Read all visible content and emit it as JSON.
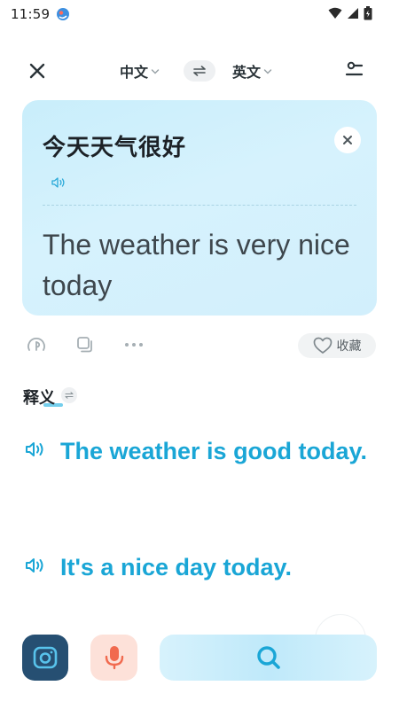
{
  "status_bar": {
    "time": "11:59"
  },
  "nav": {
    "source_lang": "中文",
    "target_lang": "英文"
  },
  "card": {
    "source_text": "今天天气很好",
    "translation": "The weather is very nice today"
  },
  "actions": {
    "favorite_label": "收藏"
  },
  "definitions": {
    "section_label": "释义",
    "items": [
      {
        "text": "The weather is good today."
      },
      {
        "text": "It's a nice day today."
      }
    ]
  },
  "colors": {
    "accent_blue": "#1aa6d6",
    "card_bg": "#d2effc",
    "camera_bg": "#264f72",
    "mic_bg": "#fde1d9",
    "mic_icon": "#f16a4f"
  },
  "icons": {
    "close": "close-icon",
    "swap": "swap-icon",
    "settings": "settings-sliders-icon",
    "clear": "clear-x-icon",
    "speaker": "speaker-icon",
    "pronunciation": "pronunciation-icon",
    "copy": "copy-icon",
    "more": "more-dots-icon",
    "heart": "heart-icon",
    "camera": "camera-icon",
    "mic": "microphone-icon",
    "search": "search-icon"
  }
}
